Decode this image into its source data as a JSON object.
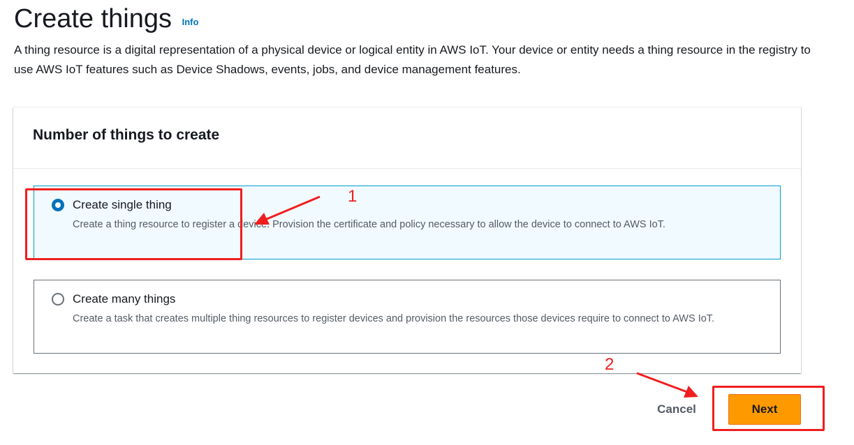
{
  "header": {
    "title": "Create things",
    "info_label": "Info",
    "description": "A thing resource is a digital representation of a physical device or logical entity in AWS IoT. Your device or entity needs a thing resource in the registry to use AWS IoT features such as Device Shadows, events, jobs, and device management features."
  },
  "panel": {
    "title": "Number of things to create",
    "options": [
      {
        "label": "Create single thing",
        "description": "Create a thing resource to register a device. Provision the certificate and policy necessary to allow the device to connect to AWS IoT.",
        "selected": true
      },
      {
        "label": "Create many things",
        "description": "Create a task that creates multiple thing resources to register devices and provision the resources those devices require to connect to AWS IoT.",
        "selected": false
      }
    ]
  },
  "actions": {
    "cancel_label": "Cancel",
    "next_label": "Next"
  },
  "annotations": {
    "step_1": "1",
    "step_2": "2",
    "color": "#f01e1e"
  },
  "colors": {
    "primary_button": "#ff9900",
    "selected_border": "#00a1c9",
    "selected_background": "#f1faff",
    "link": "#0073bb"
  }
}
